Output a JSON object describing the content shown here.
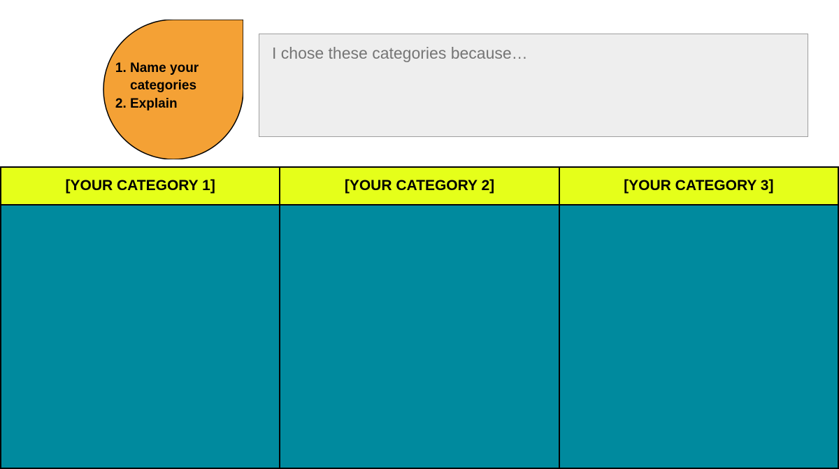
{
  "instructions": {
    "item1": "Name your categories",
    "item2": "Explain"
  },
  "explanation": {
    "placeholder": "I chose these categories because…",
    "value": ""
  },
  "categories": {
    "header1": "[YOUR CATEGORY 1]",
    "header2": "[YOUR CATEGORY 2]",
    "header3": "[YOUR CATEGORY 3]"
  },
  "colors": {
    "teardrop": "#f4a135",
    "header_bg": "#e5ff1a",
    "cell_bg": "#008a9e",
    "explanation_bg": "#eeeeee"
  }
}
